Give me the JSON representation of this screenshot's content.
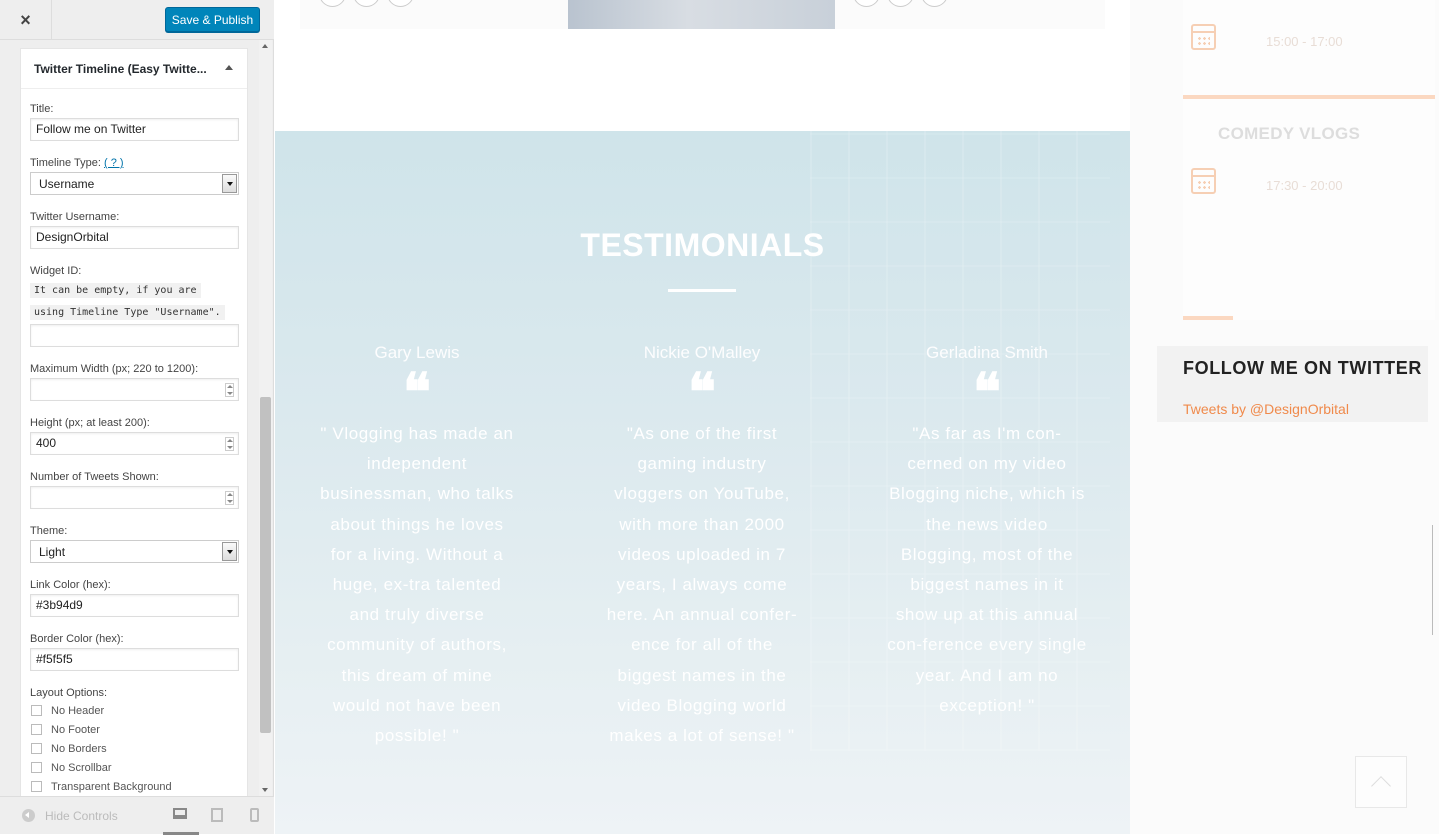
{
  "header": {
    "close_label": "×",
    "publish_label": "Save & Publish"
  },
  "widget": {
    "title": "Twitter Timeline (Easy Twitte...",
    "fields": {
      "title_label": "Title:",
      "title_value": "Follow me on Twitter",
      "timeline_type_label": "Timeline Type:",
      "timeline_type_help": "( ? )",
      "timeline_type_value": "Username",
      "username_label": "Twitter Username:",
      "username_value": "DesignOrbital",
      "widget_id_label": "Widget ID:",
      "widget_id_note_1": "It can be empty, if you are",
      "widget_id_note_2": "using Timeline Type \"Username\".",
      "widget_id_value": "",
      "max_width_label": "Maximum Width (px; 220 to 1200):",
      "max_width_value": "",
      "height_label": "Height (px; at least 200):",
      "height_value": "400",
      "tweets_label": "Number of Tweets Shown:",
      "tweets_value": "",
      "theme_label": "Theme:",
      "theme_value": "Light",
      "link_color_label": "Link Color (hex):",
      "link_color_value": "#3b94d9",
      "border_color_label": "Border Color (hex):",
      "border_color_value": "#f5f5f5",
      "layout_label": "Layout Options:"
    },
    "layout_options": [
      "No Header",
      "No Footer",
      "No Borders",
      "No Scrollbar",
      "Transparent Background"
    ]
  },
  "footer": {
    "hide_controls": "Hide Controls"
  },
  "preview": {
    "testimonials_heading": "TESTIMONIALS",
    "testimonials": [
      {
        "name": "Gary Lewis",
        "quote_mark": "❝",
        "text": "\" Vlogging has made an independent businessman, who talks about things he loves for a living. Without a huge, ex-tra talented and truly diverse community of authors, this dream of mine would not have been possible! \""
      },
      {
        "name": "Nickie O'Malley",
        "quote_mark": "❝",
        "text": "\"As one of the first gaming industry vloggers on YouTube, with more than 2000 videos uploaded in 7 years, I always come here. An annual confer-ence for all of the biggest names in the video Blogging world makes a lot of sense! \""
      },
      {
        "name": "Gerladina Smith",
        "quote_mark": "❝",
        "text": "\"As far as I'm con-cerned on my video Blogging niche, which is the news video Blogging, most of the biggest names in it show up at this annual con-ference every single year. And I am no exception! \""
      }
    ],
    "events": [
      {
        "title": "",
        "time": "15:00 - 17:00"
      },
      {
        "title": "COMEDY VLOGS",
        "time": "17:30 - 20:00"
      }
    ],
    "twitter_title": "FOLLOW ME ON TWITTER",
    "twitter_link": "Tweets by @DesignOrbital"
  },
  "colors": {
    "accent": "#0085ba",
    "link": "#0073aa",
    "orange": "#f08a4b"
  }
}
